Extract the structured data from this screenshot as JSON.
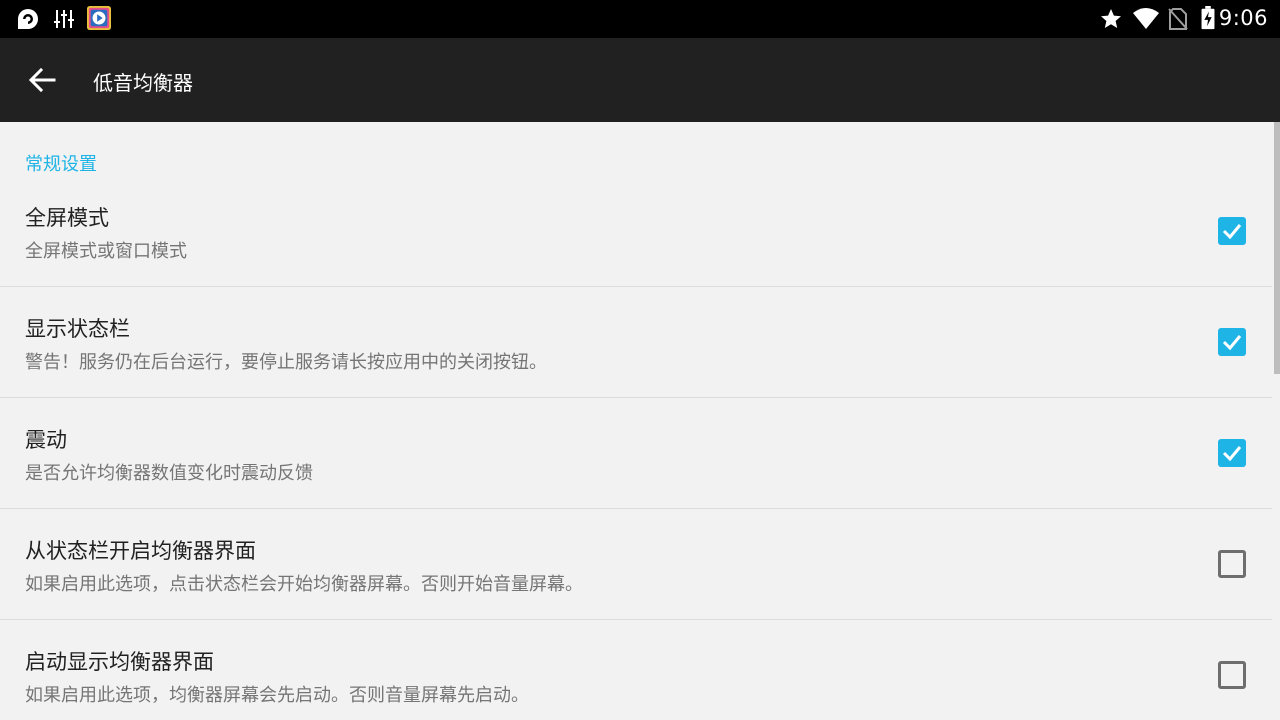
{
  "status_bar": {
    "time": "9:06",
    "left_icons": [
      "pocket-casts-icon",
      "equalizer-sliders-icon",
      "video-app-icon"
    ],
    "right_icons": [
      "star-icon",
      "wifi-icon",
      "no-sim-icon",
      "battery-charging-icon"
    ]
  },
  "app_bar": {
    "title": "低音均衡器",
    "back_icon": "arrow-left-icon"
  },
  "section": {
    "title": "常规设置"
  },
  "preferences": [
    {
      "title": "全屏模式",
      "summary": "全屏模式或窗口模式",
      "checked": true
    },
    {
      "title": "显示状态栏",
      "summary": "警告！服务仍在后台运行，要停止服务请长按应用中的关闭按钮。",
      "checked": true
    },
    {
      "title": "震动",
      "summary": "是否允许均衡器数值变化时震动反馈",
      "checked": true
    },
    {
      "title": "从状态栏开启均衡器界面",
      "summary": "如果启用此选项，点击状态栏会开始均衡器屏幕。否则开始音量屏幕。",
      "checked": false
    },
    {
      "title": "启动显示均衡器界面",
      "summary": "如果启用此选项，均衡器屏幕会先启动。否则音量屏幕先启动。",
      "checked": false
    }
  ],
  "colors": {
    "accent": "#1fb4e6",
    "app_bar": "#212121",
    "status_bar": "#000000",
    "background": "#f2f2f2"
  }
}
